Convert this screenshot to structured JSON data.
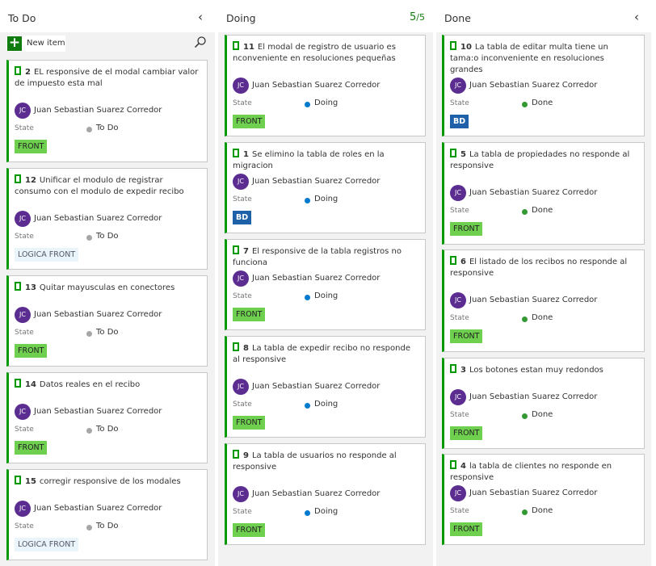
{
  "colors": {
    "done_accent": "#107c10",
    "card_border_left": "#009900",
    "todo_state": "#a6a6a6",
    "doing_state": "#007acc",
    "done_state": "#339933",
    "tag_front": "#6fd04f",
    "tag_bd": "#1f61a8",
    "avatar": "#5c2d91"
  },
  "icons": {
    "collapse": "chevron-left-icon",
    "search": "search-icon",
    "add": "plus-icon",
    "work_item": "user-story-icon"
  },
  "state_label": "State",
  "columns": [
    {
      "title": "To Do",
      "collapse_glyph": "‹",
      "new_item_label": "New item",
      "cards": [
        {
          "id": "2",
          "title": "EL responsive de el modal cambiar valor de impuesto esta mal",
          "avatar": "JC",
          "assignee": "Juan Sebastian Suarez Corredor",
          "state": "To Do",
          "tag": "FRONT"
        },
        {
          "id": "12",
          "title": "Unificar el modulo de registrar consumo con el modulo de expedir recibo",
          "avatar": "JC",
          "assignee": "Juan Sebastian Suarez Corredor",
          "state": "To Do",
          "tag": "LOGICA FRONT"
        },
        {
          "id": "13",
          "title": "Quitar mayusculas en conectores",
          "avatar": "JC",
          "assignee": "Juan Sebastian Suarez Corredor",
          "state": "To Do",
          "tag": "FRONT"
        },
        {
          "id": "14",
          "title": "Datos reales en el recibo",
          "avatar": "JC",
          "assignee": "Juan Sebastian Suarez Corredor",
          "state": "To Do",
          "tag": "FRONT"
        },
        {
          "id": "15",
          "title": "corregir responsive de los modales",
          "avatar": "JC",
          "assignee": "Juan Sebastian Suarez Corredor",
          "state": "To Do",
          "tag": "LOGICA FRONT"
        }
      ]
    },
    {
      "title": "Doing",
      "count": "5",
      "limit": "/5",
      "cards": [
        {
          "id": "11",
          "title": "El modal de registro de usuario es nconveniente en resoluciones pequeñas",
          "avatar": "JC",
          "assignee": "Juan Sebastian Suarez Corredor",
          "state": "Doing",
          "tag": "FRONT"
        },
        {
          "id": "1",
          "title": "Se elimino la tabla de roles en la migracion",
          "avatar": "JC",
          "assignee": "Juan Sebastian Suarez Corredor",
          "state": "Doing",
          "tag": "BD"
        },
        {
          "id": "7",
          "title": "El responsive de la tabla registros no funciona",
          "avatar": "JC",
          "assignee": "Juan Sebastian Suarez Corredor",
          "state": "Doing",
          "tag": "FRONT"
        },
        {
          "id": "8",
          "title": "La tabla de expedir recibo no responde al responsive",
          "avatar": "JC",
          "assignee": "Juan Sebastian Suarez Corredor",
          "state": "Doing",
          "tag": "FRONT"
        },
        {
          "id": "9",
          "title": "La tabla de usuarios no responde al responsive",
          "avatar": "JC",
          "assignee": "Juan Sebastian Suarez Corredor",
          "state": "Doing",
          "tag": "FRONT"
        }
      ]
    },
    {
      "title": "Done",
      "collapse_glyph": "‹",
      "cards": [
        {
          "id": "10",
          "title": "La tabla de editar multa tiene un tama:o inconveniente en resoluciones grandes",
          "avatar": "JC",
          "assignee": "Juan Sebastian Suarez Corredor",
          "state": "Done",
          "tag": "BD"
        },
        {
          "id": "5",
          "title": "La tabla de propiedades no responde al responsive",
          "avatar": "JC",
          "assignee": "Juan Sebastian Suarez Corredor",
          "state": "Done",
          "tag": "FRONT"
        },
        {
          "id": "6",
          "title": "El listado de los recibos no responde al responsive",
          "avatar": "JC",
          "assignee": "Juan Sebastian Suarez Corredor",
          "state": "Done",
          "tag": "FRONT"
        },
        {
          "id": "3",
          "title": "Los botones estan muy redondos",
          "avatar": "JC",
          "assignee": "Juan Sebastian Suarez Corredor",
          "state": "Done",
          "tag": "FRONT"
        },
        {
          "id": "4",
          "title": "la tabla de clientes no responde en responsive",
          "avatar": "JC",
          "assignee": "Juan Sebastian Suarez Corredor",
          "state": "Done",
          "tag": "FRONT"
        }
      ]
    }
  ]
}
